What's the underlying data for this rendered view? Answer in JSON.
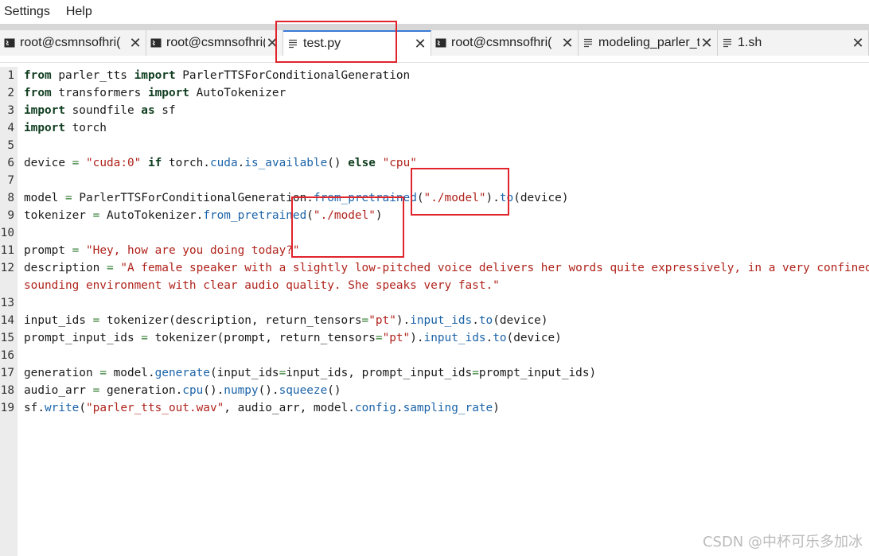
{
  "menu": {
    "settings": "Settings",
    "help": "Help"
  },
  "tabs": [
    {
      "label": "root@csmnsofhri(",
      "icon": "terminal-icon",
      "active": false
    },
    {
      "label": "root@csmnsofhri(",
      "icon": "terminal-icon",
      "active": false
    },
    {
      "label": "test.py",
      "icon": "document-icon",
      "active": true
    },
    {
      "label": "root@csmnsofhri(",
      "icon": "terminal-icon",
      "active": false
    },
    {
      "label": "modeling_parler_t",
      "icon": "document-icon",
      "active": false
    },
    {
      "label": "1.sh",
      "icon": "document-icon",
      "active": false
    }
  ],
  "tab_close_glyph": "✕",
  "editor": {
    "line_numbers": [
      "1",
      "2",
      "3",
      "4",
      "5",
      "6",
      "7",
      "8",
      "9",
      "10",
      "11",
      "12",
      "",
      "13",
      "14",
      "15",
      "16",
      "17",
      "18",
      "19"
    ],
    "lines": [
      [
        [
          "kw",
          "from"
        ],
        [
          "plain",
          " parler_tts "
        ],
        [
          "kw",
          "import"
        ],
        [
          "plain",
          " ParlerTTSForConditionalGeneration"
        ]
      ],
      [
        [
          "kw",
          "from"
        ],
        [
          "plain",
          " transformers "
        ],
        [
          "kw",
          "import"
        ],
        [
          "plain",
          " AutoTokenizer"
        ]
      ],
      [
        [
          "kw",
          "import"
        ],
        [
          "plain",
          " soundfile "
        ],
        [
          "kw",
          "as"
        ],
        [
          "plain",
          " sf"
        ]
      ],
      [
        [
          "kw",
          "import"
        ],
        [
          "plain",
          " torch"
        ]
      ],
      [],
      [
        [
          "plain",
          "device "
        ],
        [
          "op",
          "="
        ],
        [
          "plain",
          " "
        ],
        [
          "str",
          "\"cuda:0\""
        ],
        [
          "plain",
          " "
        ],
        [
          "kw",
          "if"
        ],
        [
          "plain",
          " torch."
        ],
        [
          "fn",
          "cuda"
        ],
        [
          "plain",
          "."
        ],
        [
          "fn",
          "is_available"
        ],
        [
          "plain",
          "() "
        ],
        [
          "kw",
          "else"
        ],
        [
          "plain",
          " "
        ],
        [
          "str",
          "\"cpu\""
        ]
      ],
      [],
      [
        [
          "plain",
          "model "
        ],
        [
          "op",
          "="
        ],
        [
          "plain",
          " ParlerTTSForConditionalGeneration."
        ],
        [
          "fn",
          "from_pretrained"
        ],
        [
          "plain",
          "("
        ],
        [
          "str",
          "\"./model\""
        ],
        [
          "plain",
          ")."
        ],
        [
          "fn",
          "to"
        ],
        [
          "plain",
          "(device)"
        ]
      ],
      [
        [
          "plain",
          "tokenizer "
        ],
        [
          "op",
          "="
        ],
        [
          "plain",
          " AutoTokenizer."
        ],
        [
          "fn",
          "from_pretrained"
        ],
        [
          "plain",
          "("
        ],
        [
          "str",
          "\"./model\""
        ],
        [
          "plain",
          ")"
        ]
      ],
      [],
      [
        [
          "plain",
          "prompt "
        ],
        [
          "op",
          "="
        ],
        [
          "plain",
          " "
        ],
        [
          "str",
          "\"Hey, how are you doing today?\""
        ]
      ],
      [
        [
          "plain",
          "description "
        ],
        [
          "op",
          "="
        ],
        [
          "plain",
          " "
        ],
        [
          "str",
          "\"A female speaker with a slightly low-pitched voice delivers her words quite expressively, in a very confined"
        ]
      ],
      [
        [
          "str",
          "sounding environment with clear audio quality. She speaks very fast.\""
        ]
      ],
      [],
      [
        [
          "plain",
          "input_ids "
        ],
        [
          "op",
          "="
        ],
        [
          "plain",
          " tokenizer(description, return_tensors"
        ],
        [
          "op",
          "="
        ],
        [
          "str",
          "\"pt\""
        ],
        [
          "plain",
          ")."
        ],
        [
          "fn",
          "input_ids"
        ],
        [
          "plain",
          "."
        ],
        [
          "fn",
          "to"
        ],
        [
          "plain",
          "(device)"
        ]
      ],
      [
        [
          "plain",
          "prompt_input_ids "
        ],
        [
          "op",
          "="
        ],
        [
          "plain",
          " tokenizer(prompt, return_tensors"
        ],
        [
          "op",
          "="
        ],
        [
          "str",
          "\"pt\""
        ],
        [
          "plain",
          ")."
        ],
        [
          "fn",
          "input_ids"
        ],
        [
          "plain",
          "."
        ],
        [
          "fn",
          "to"
        ],
        [
          "plain",
          "(device)"
        ]
      ],
      [],
      [
        [
          "plain",
          "generation "
        ],
        [
          "op",
          "="
        ],
        [
          "plain",
          " model."
        ],
        [
          "fn",
          "generate"
        ],
        [
          "plain",
          "(input_ids"
        ],
        [
          "op",
          "="
        ],
        [
          "plain",
          "input_ids, prompt_input_ids"
        ],
        [
          "op",
          "="
        ],
        [
          "plain",
          "prompt_input_ids)"
        ]
      ],
      [
        [
          "plain",
          "audio_arr "
        ],
        [
          "op",
          "="
        ],
        [
          "plain",
          " generation."
        ],
        [
          "fn",
          "cpu"
        ],
        [
          "plain",
          "()."
        ],
        [
          "fn",
          "numpy"
        ],
        [
          "plain",
          "()."
        ],
        [
          "fn",
          "squeeze"
        ],
        [
          "plain",
          "()"
        ]
      ],
      [
        [
          "plain",
          "sf."
        ],
        [
          "fn",
          "write"
        ],
        [
          "plain",
          "("
        ],
        [
          "str",
          "\"parler_tts_out.wav\""
        ],
        [
          "plain",
          ", audio_arr, model."
        ],
        [
          "fn",
          "config"
        ],
        [
          "plain",
          "."
        ],
        [
          "fn",
          "sampling_rate"
        ],
        [
          "plain",
          ")"
        ]
      ]
    ]
  },
  "watermark": "CSDN @中杯可乐多加冰",
  "colors": {
    "keyword": "#0f3d1f",
    "string": "#b0231c",
    "function": "#1b63a8",
    "operator": "#2c7a2c",
    "highlight": "#e0242c",
    "active_tab_accent": "#3b7bd6"
  }
}
